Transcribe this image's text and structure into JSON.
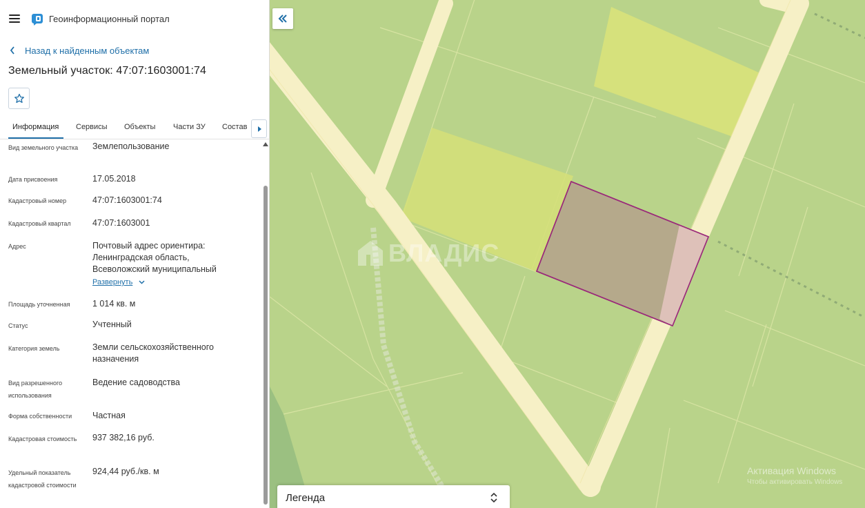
{
  "header": {
    "app_title": "Геоинформационный портал"
  },
  "nav": {
    "back_label": "Назад к найденным объектам"
  },
  "object": {
    "title": "Земельный участок: 47:07:1603001:74"
  },
  "tabs": [
    {
      "label": "Информация",
      "active": true
    },
    {
      "label": "Сервисы"
    },
    {
      "label": "Объекты"
    },
    {
      "label": "Части ЗУ"
    },
    {
      "label": "Состав"
    }
  ],
  "properties": [
    {
      "label": "Вид земельного участка",
      "value": "Землепользование"
    },
    {
      "label": "Дата присвоения",
      "value": "17.05.2018"
    },
    {
      "label": "Кадастровый номер",
      "value": "47:07:1603001:74"
    },
    {
      "label": "Кадастровый квартал",
      "value": "47:07:1603001"
    },
    {
      "label": "Адрес",
      "value": "Почтовый адрес ориентира: Ленинградская область, Всеволожский муниципальный"
    },
    {
      "label": "Площадь уточненная",
      "value": "1 014 кв. м"
    },
    {
      "label": "Статус",
      "value": "Учтенный"
    },
    {
      "label": "Категория земель",
      "value": "Земли сельскохозяйственного назначения"
    },
    {
      "label": "Вид разрешенного использования",
      "value": "Ведение садоводства"
    },
    {
      "label": "Форма собственности",
      "value": "Частная"
    },
    {
      "label": "Кадастровая стоимость",
      "value": "937 382,16 руб."
    },
    {
      "label": "Удельный показатель кадастровой стоимости",
      "value": "924,44 руб./кв. м"
    }
  ],
  "expand_label": "Развернуть",
  "map": {
    "legend_label": "Легенда",
    "watermark": "ВЛАДИС",
    "windows_activation": "Активация Windows",
    "windows_activation_sub": "Чтобы активировать Windows",
    "colors": {
      "background": "#b9d38a",
      "road": "#f5f0c4",
      "highlight_parcel": "#d9e27a",
      "selected_parcel_fill": "#b7ab8c",
      "selected_parcel_border": "#9a2a7a",
      "accent_link": "#1f6fa8"
    }
  }
}
